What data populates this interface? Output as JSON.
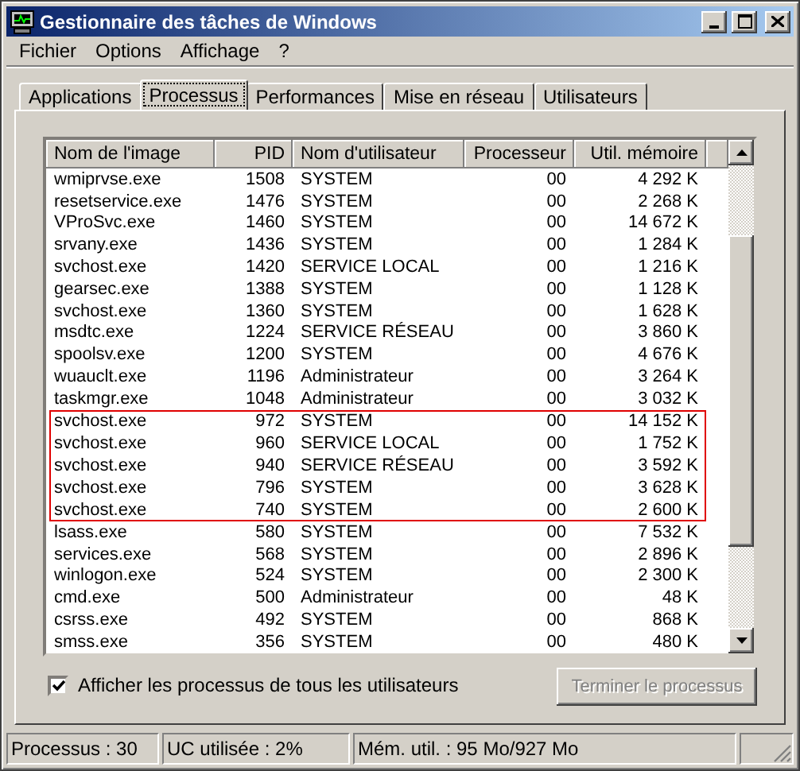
{
  "window": {
    "title": "Gestionnaire des tâches de Windows"
  },
  "menu": [
    "Fichier",
    "Options",
    "Affichage",
    "?"
  ],
  "tabs": [
    {
      "label": "Applications",
      "selected": false
    },
    {
      "label": "Processus",
      "selected": true
    },
    {
      "label": "Performances",
      "selected": false
    },
    {
      "label": "Mise en réseau",
      "selected": false
    },
    {
      "label": "Utilisateurs",
      "selected": false
    }
  ],
  "table": {
    "columns": [
      "Nom de l'image",
      "PID",
      "Nom d'utilisateur",
      "Processeur",
      "Util. mémoire"
    ],
    "rows": [
      {
        "name": "wmiprvse.exe",
        "pid": "1508",
        "user": "SYSTEM",
        "cpu": "00",
        "mem": "4 292 K",
        "highlighted": false
      },
      {
        "name": "resetservice.exe",
        "pid": "1476",
        "user": "SYSTEM",
        "cpu": "00",
        "mem": "2 268 K",
        "highlighted": false
      },
      {
        "name": "VProSvc.exe",
        "pid": "1460",
        "user": "SYSTEM",
        "cpu": "00",
        "mem": "14 672 K",
        "highlighted": false
      },
      {
        "name": "srvany.exe",
        "pid": "1436",
        "user": "SYSTEM",
        "cpu": "00",
        "mem": "1 284 K",
        "highlighted": false
      },
      {
        "name": "svchost.exe",
        "pid": "1420",
        "user": "SERVICE LOCAL",
        "cpu": "00",
        "mem": "1 216 K",
        "highlighted": false
      },
      {
        "name": "gearsec.exe",
        "pid": "1388",
        "user": "SYSTEM",
        "cpu": "00",
        "mem": "1 128 K",
        "highlighted": false
      },
      {
        "name": "svchost.exe",
        "pid": "1360",
        "user": "SYSTEM",
        "cpu": "00",
        "mem": "1 628 K",
        "highlighted": false
      },
      {
        "name": "msdtc.exe",
        "pid": "1224",
        "user": "SERVICE RÉSEAU",
        "cpu": "00",
        "mem": "3 860 K",
        "highlighted": false
      },
      {
        "name": "spoolsv.exe",
        "pid": "1200",
        "user": "SYSTEM",
        "cpu": "00",
        "mem": "4 676 K",
        "highlighted": false
      },
      {
        "name": "wuauclt.exe",
        "pid": "1196",
        "user": "Administrateur",
        "cpu": "00",
        "mem": "3 264 K",
        "highlighted": false
      },
      {
        "name": "taskmgr.exe",
        "pid": "1048",
        "user": "Administrateur",
        "cpu": "00",
        "mem": "3 032 K",
        "highlighted": false
      },
      {
        "name": "svchost.exe",
        "pid": "972",
        "user": "SYSTEM",
        "cpu": "00",
        "mem": "14 152 K",
        "highlighted": true
      },
      {
        "name": "svchost.exe",
        "pid": "960",
        "user": "SERVICE LOCAL",
        "cpu": "00",
        "mem": "1 752 K",
        "highlighted": true
      },
      {
        "name": "svchost.exe",
        "pid": "940",
        "user": "SERVICE RÉSEAU",
        "cpu": "00",
        "mem": "3 592 K",
        "highlighted": true
      },
      {
        "name": "svchost.exe",
        "pid": "796",
        "user": "SYSTEM",
        "cpu": "00",
        "mem": "3 628 K",
        "highlighted": true
      },
      {
        "name": "svchost.exe",
        "pid": "740",
        "user": "SYSTEM",
        "cpu": "00",
        "mem": "2 600 K",
        "highlighted": true
      },
      {
        "name": "lsass.exe",
        "pid": "580",
        "user": "SYSTEM",
        "cpu": "00",
        "mem": "7 532 K",
        "highlighted": false
      },
      {
        "name": "services.exe",
        "pid": "568",
        "user": "SYSTEM",
        "cpu": "00",
        "mem": "2 896 K",
        "highlighted": false
      },
      {
        "name": "winlogon.exe",
        "pid": "524",
        "user": "SYSTEM",
        "cpu": "00",
        "mem": "2 300 K",
        "highlighted": false
      },
      {
        "name": "cmd.exe",
        "pid": "500",
        "user": "Administrateur",
        "cpu": "00",
        "mem": "48 K",
        "highlighted": false
      },
      {
        "name": "csrss.exe",
        "pid": "492",
        "user": "SYSTEM",
        "cpu": "00",
        "mem": "868 K",
        "highlighted": false
      },
      {
        "name": "smss.exe",
        "pid": "356",
        "user": "SYSTEM",
        "cpu": "00",
        "mem": "480 K",
        "highlighted": false
      }
    ]
  },
  "show_all": {
    "label": "Afficher les processus de tous les utilisateurs",
    "checked": true
  },
  "end_button": {
    "label": "Terminer le processus",
    "disabled": true
  },
  "status_bar": [
    "Processus : 30",
    "UC utilisée : 2%",
    "Mém. util. : 95 Mo/927 Mo"
  ]
}
